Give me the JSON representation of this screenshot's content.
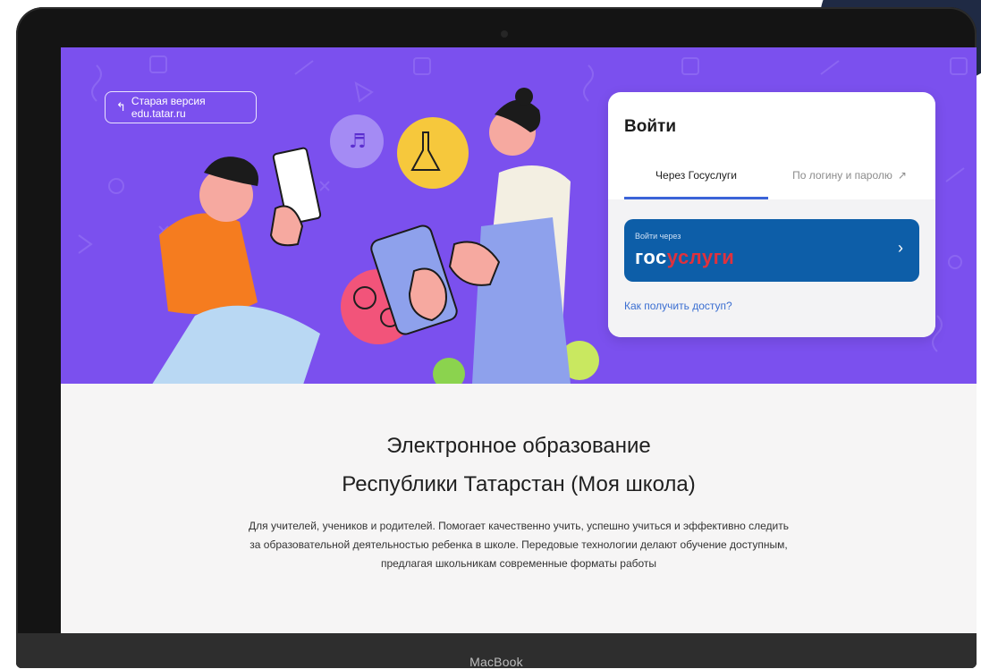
{
  "old_version": {
    "arrow": "↰",
    "label": "Старая версия edu.tatar.ru"
  },
  "login": {
    "title": "Войти",
    "tabs": [
      {
        "label": "Через Госуслуги",
        "active": true
      },
      {
        "label": "По логину и паролю",
        "icon": "↗",
        "active": false
      }
    ],
    "gosuslugi_button": {
      "small_label": "Войти через",
      "logo_part1": "гос",
      "logo_part2": "услуги",
      "chevron": "›"
    },
    "access_link": "Как получить доступ?"
  },
  "headline": {
    "line1": "Электронное образование",
    "line2": "Республики Татарстан (Моя школа)"
  },
  "description": {
    "line1": "Для учителей, учеников и родителей. Помогает качественно учить, успешно учиться и эффективно следить",
    "line2": "за образовательной деятельностью ребенка в школе. Передовые технологии делают обучение доступным,",
    "line3": "предлагая школьникам современные форматы работы"
  },
  "device_label": "MacBook",
  "colors": {
    "hero_bg": "#7b50ee",
    "gosuslugi_blue": "#0d5ea8",
    "gosuslugi_red": "#e0313d",
    "link_blue": "#3a6ed1",
    "tab_underline": "#3b63d8"
  }
}
